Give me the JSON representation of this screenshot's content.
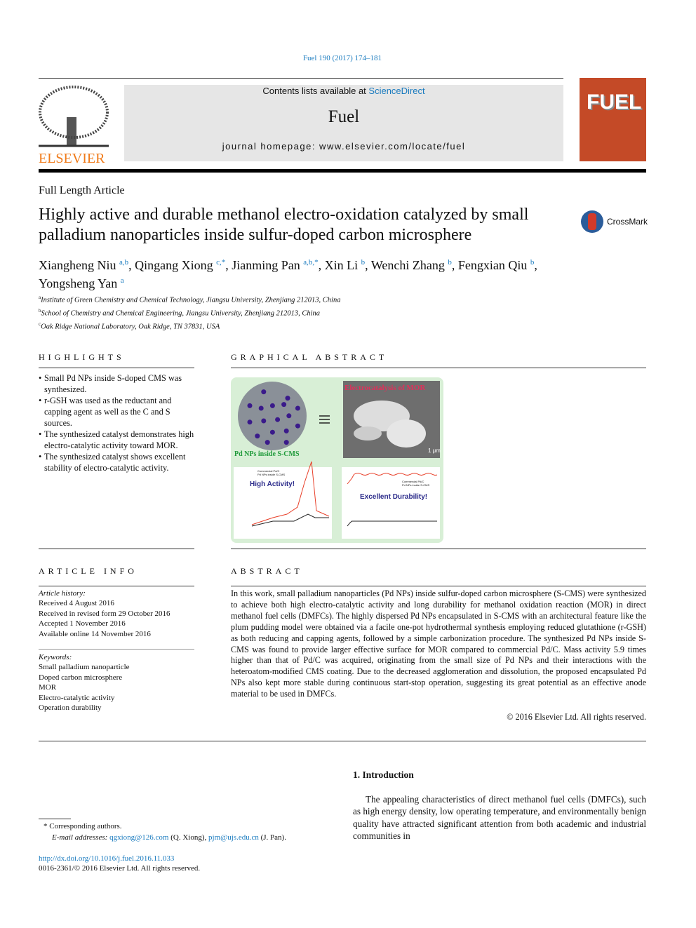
{
  "citation": "Fuel 190 (2017) 174–181",
  "header": {
    "contents_prefix": "Contents lists available at ",
    "sciencedirect": "ScienceDirect",
    "journal": "Fuel",
    "homepage": "journal homepage: www.elsevier.com/locate/fuel",
    "publisher": "ELSEVIER",
    "cover_title": "FUEL"
  },
  "article_type": "Full Length Article",
  "title": "Highly active and durable methanol electro-oxidation catalyzed by small palladium nanoparticles inside sulfur-doped carbon microsphere",
  "crossmark": "CrossMark",
  "authors": [
    {
      "name": "Xiangheng Niu",
      "sup": "a,b"
    },
    {
      "name": "Qingang Xiong",
      "sup": "c,*"
    },
    {
      "name": "Jianming Pan",
      "sup": "a,b,*"
    },
    {
      "name": "Xin Li",
      "sup": "b"
    },
    {
      "name": "Wenchi Zhang",
      "sup": "b"
    },
    {
      "name": "Fengxian Qiu",
      "sup": "b"
    },
    {
      "name": "Yongsheng Yan",
      "sup": "a"
    }
  ],
  "affiliations": [
    {
      "sup": "a",
      "text": "Institute of Green Chemistry and Chemical Technology, Jiangsu University, Zhenjiang 212013, China"
    },
    {
      "sup": "b",
      "text": "School of Chemistry and Chemical Engineering, Jiangsu University, Zhenjiang 212013, China"
    },
    {
      "sup": "c",
      "text": "Oak Ridge National Laboratory, Oak Ridge, TN 37831, USA"
    }
  ],
  "highlights": {
    "heading": "HIGHLIGHTS",
    "items": [
      "Small Pd NPs inside S-doped CMS was synthesized.",
      "r-GSH was used as the reductant and capping agent as well as the C and S sources.",
      "The synthesized catalyst demonstrates high electro-catalytic activity toward MOR.",
      "The synthesized catalyst shows excellent stability of electro-catalytic activity."
    ]
  },
  "graphical_abstract": {
    "heading": "GRAPHICAL ABSTRACT",
    "label_sphere": "Pd NPs inside S-CMS",
    "label_sem": "Electrocatalysis of MOR",
    "scale": "1 μm",
    "chart1_text": "High Activity!",
    "chart2_text": "Excellent Durability!",
    "legend": [
      "Commercial Pd/C",
      "Pd NPs inside S-CMS"
    ],
    "colors": {
      "background": "#d8efd6",
      "particle": "#3a1a8a",
      "sphere": "#8a9098",
      "red": "#e8402a"
    }
  },
  "article_info": {
    "heading": "ARTICLE INFO",
    "history_label": "Article history:",
    "history": [
      "Received 4 August 2016",
      "Received in revised form 29 October 2016",
      "Accepted 1 November 2016",
      "Available online 14 November 2016"
    ],
    "keywords_label": "Keywords:",
    "keywords": [
      "Small palladium nanoparticle",
      "Doped carbon microsphere",
      "MOR",
      "Electro-catalytic activity",
      "Operation durability"
    ]
  },
  "abstract": {
    "heading": "ABSTRACT",
    "text": "In this work, small palladium nanoparticles (Pd NPs) inside sulfur-doped carbon microsphere (S-CMS) were synthesized to achieve both high electro-catalytic activity and long durability for methanol oxidation reaction (MOR) in direct methanol fuel cells (DMFCs). The highly dispersed Pd NPs encapsulated in S-CMS with an architectural feature like the plum pudding model were obtained via a facile one-pot hydrothermal synthesis employing reduced glutathione (r-GSH) as both reducing and capping agents, followed by a simple carbonization procedure. The synthesized Pd NPs inside S-CMS was found to provide larger effective surface for MOR compared to commercial Pd/C. Mass activity 5.9 times higher than that of Pd/C was acquired, originating from the small size of Pd NPs and their interactions with the heteroatom-modified CMS coating. Due to the decreased agglomeration and dissolution, the proposed encapsulated Pd NPs also kept more stable during continuous start-stop operation, suggesting its great potential as an effective anode material to be used in DMFCs.",
    "copyright": "© 2016 Elsevier Ltd. All rights reserved."
  },
  "footnote": {
    "corresponding": "Corresponding authors.",
    "email_label": "E-mail addresses:",
    "email1": "qgxiong@126.com",
    "name1": " (Q. Xiong), ",
    "email2": "pjm@ujs.edu.cn",
    "name2": " (J. Pan)."
  },
  "doi": "http://dx.doi.org/10.1016/j.fuel.2016.11.033",
  "issn": "0016-2361/© 2016 Elsevier Ltd. All rights reserved.",
  "intro": {
    "heading": "1. Introduction",
    "text": "The appealing characteristics of direct methanol fuel cells (DMFCs), such as high energy density, low operating temperature, and environmentally benign quality have attracted significant attention from both academic and industrial communities in"
  }
}
